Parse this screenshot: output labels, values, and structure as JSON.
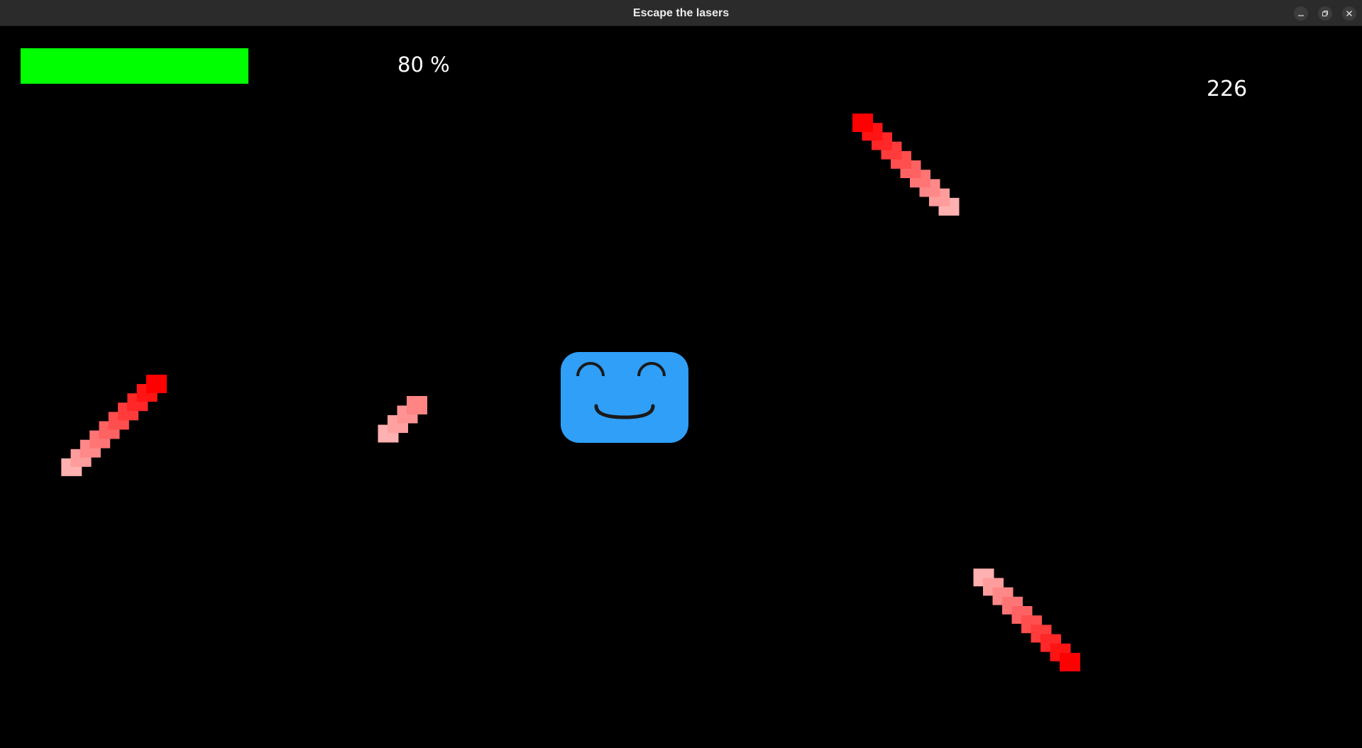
{
  "window": {
    "title": "Escape the lasers",
    "controls": {
      "minimize_icon": "minimize-icon",
      "maximize_icon": "maximize-icon",
      "close_icon": "close-icon"
    }
  },
  "hud": {
    "health_fraction": 0.8,
    "health_text": "80 %",
    "health_color": "#00ff00",
    "score": "226"
  },
  "colors": {
    "background": "#000000",
    "player": "#2f9ff8",
    "player_features": "#1a1a1a",
    "laser_head": "#ff0000",
    "laser_tail": "#ffb0b0"
  },
  "lasers": [
    {
      "id": "laser-top-right",
      "segments": 10
    },
    {
      "id": "laser-left",
      "segments": 10
    },
    {
      "id": "laser-center",
      "segments": 4
    },
    {
      "id": "laser-bottom-right",
      "segments": 10
    }
  ],
  "player": {
    "icon": "smiley-face-icon",
    "expression": "happy"
  }
}
